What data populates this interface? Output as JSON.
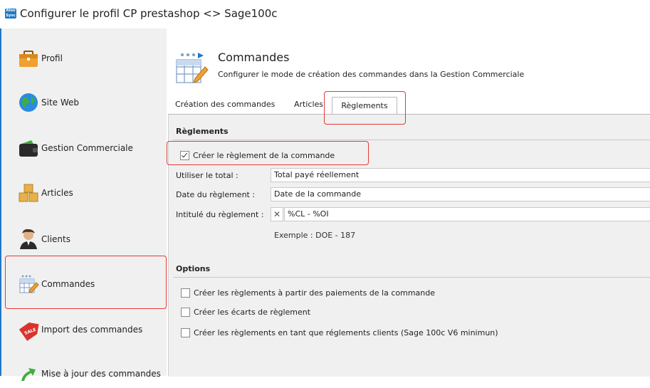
{
  "window": {
    "app_icon_text": "Atoo Sync",
    "title": "Configurer le profil CP prestashop <> Sage100c"
  },
  "sidebar": {
    "items": [
      {
        "label": "Profil",
        "icon": "briefcase-icon"
      },
      {
        "label": "Site Web",
        "icon": "globe-icon"
      },
      {
        "label": "Gestion Commerciale",
        "icon": "wallet-icon"
      },
      {
        "label": "Articles",
        "icon": "boxes-icon"
      },
      {
        "label": "Clients",
        "icon": "user-icon"
      },
      {
        "label": "Commandes",
        "icon": "order-grid-icon",
        "selected": true
      },
      {
        "label": "Import des commandes",
        "icon": "sale-tag-icon"
      },
      {
        "label": "Mise à jour des commandes",
        "icon": "update-arrow-icon"
      }
    ]
  },
  "header": {
    "title": "Commandes",
    "subtitle": "Configurer le mode de création des commandes dans la Gestion Commerciale"
  },
  "tabs": [
    {
      "label": "Création des commandes"
    },
    {
      "label": "Articles"
    },
    {
      "label": "Règlements",
      "active": true
    }
  ],
  "reglements": {
    "section_title": "Règlements",
    "create_checkbox": {
      "label": "Créer le règlement de la commande",
      "checked": true
    },
    "fields": [
      {
        "label": "Utiliser le total :",
        "value": "Total payé réellement"
      },
      {
        "label": "Date du règlement :",
        "value": "Date de la commande"
      },
      {
        "label": "Intitulé du règlement :",
        "value": "%CL - %OI"
      }
    ],
    "example": "Exemple : DOE - 187"
  },
  "options": {
    "section_title": "Options",
    "checkboxes": [
      {
        "label": "Créer les règlements à partir des paiements de la commande",
        "checked": false
      },
      {
        "label": "Créer les écarts de règlement",
        "checked": false
      },
      {
        "label": "Créer les règlements en tant que réglements clients (Sage 100c V6 minimun)",
        "checked": false
      }
    ]
  },
  "colors": {
    "accent_blue": "#1e78c8",
    "highlight_red": "#e53935",
    "panel_bg": "#f0f0f0"
  }
}
